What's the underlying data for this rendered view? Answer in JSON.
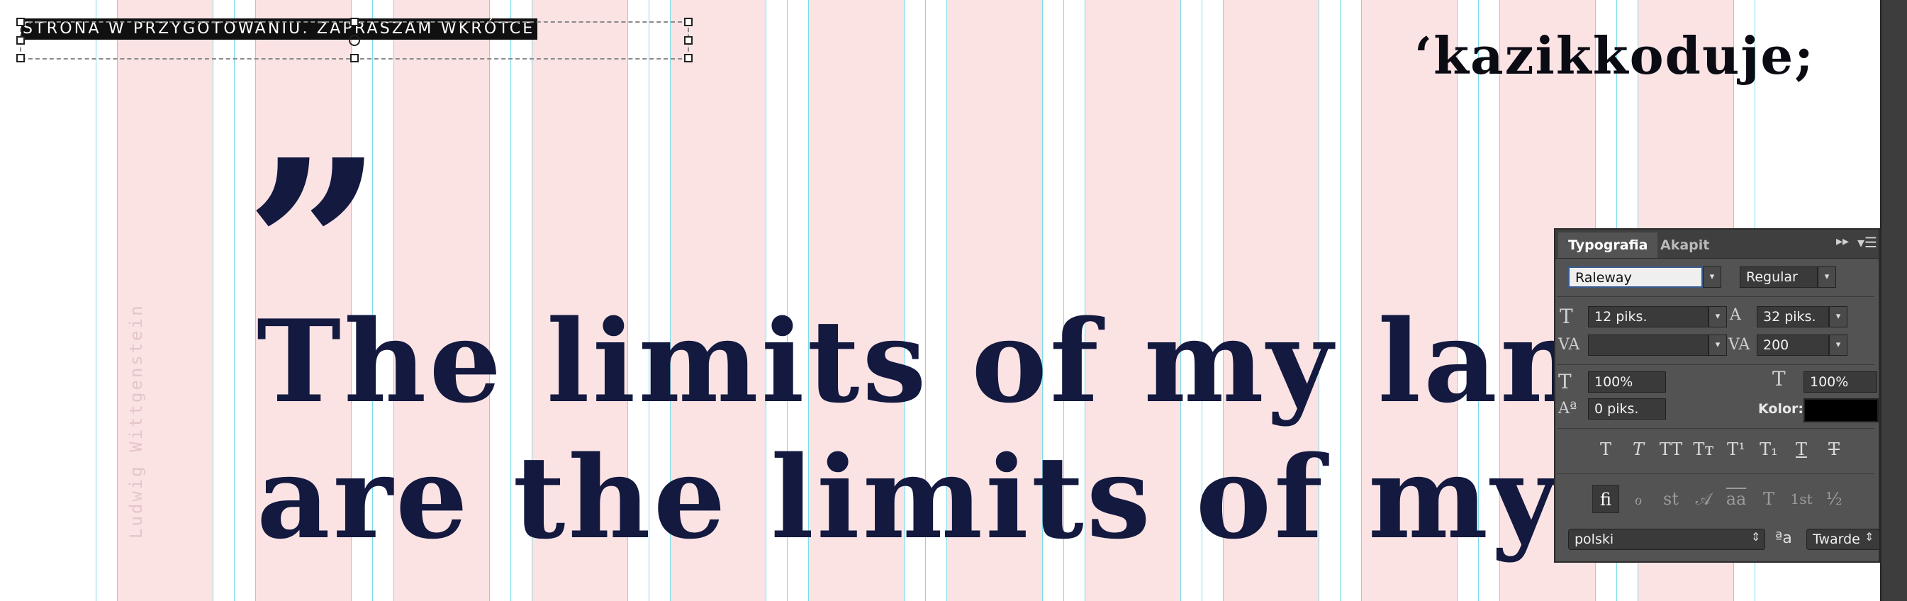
{
  "canvas": {
    "heading_text": "STRONA W PRZYGOTOWANIU. ZAPRASZAM WKRÓTCE",
    "logo_text": "ʻkazikkoduje;",
    "quote_mark": "”",
    "quote_line_1": "The limits of my language",
    "quote_line_2": "are the limits of my world",
    "author": "Ludwig Wittgenstein"
  },
  "panel": {
    "tabs": [
      "Typografia",
      "Akapit"
    ],
    "font_family": "Raleway",
    "font_style": "Regular",
    "font_size": "12 piks.",
    "leading": "32 piks.",
    "kerning": "",
    "tracking": "200",
    "vertical_scale": "100%",
    "horizontal_scale": "100%",
    "baseline_shift": "0 piks.",
    "color_label": "Kolor:",
    "color_value": "#000000",
    "language": "polski",
    "aa_icon": "ªa",
    "antialias": "Twarde",
    "style_buttons": [
      "T",
      "T",
      "TT",
      "Tᴛ",
      "T¹",
      "T₁",
      "T",
      "T"
    ],
    "opentype_buttons": [
      "ﬁ",
      "ℴ",
      "st",
      "𝒜",
      "aa",
      "T",
      "1st",
      "½"
    ]
  },
  "colors": {
    "column_pink": "#fbe3e4",
    "guide_cyan": "#79dceb",
    "quote_navy": "#13193f",
    "panel_bg": "#535353"
  }
}
